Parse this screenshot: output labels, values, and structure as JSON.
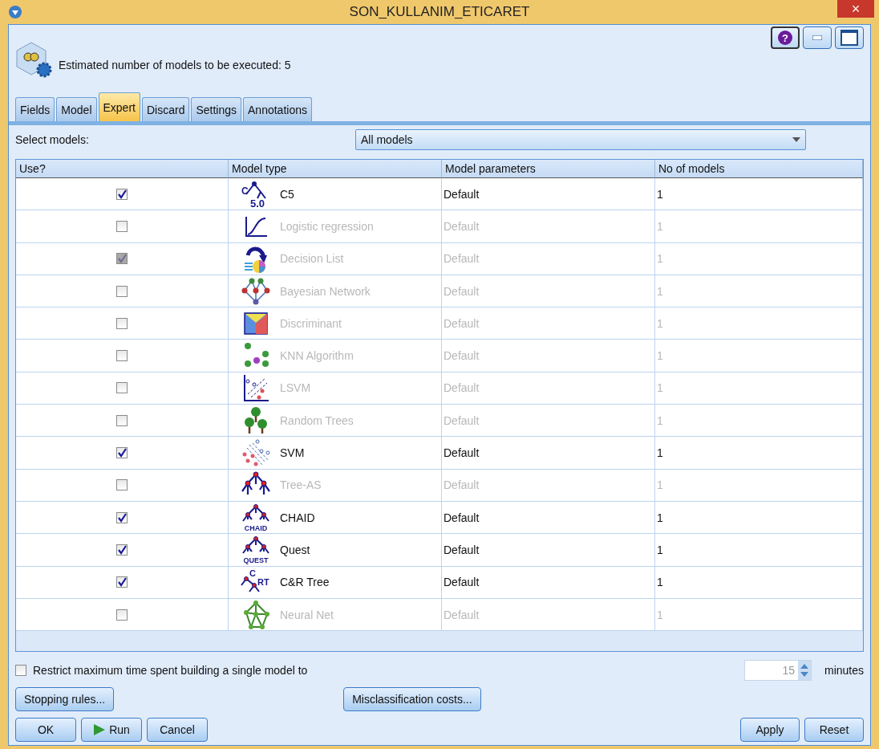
{
  "window": {
    "title": "SON_KULLANIM_ETICARET",
    "close": "×"
  },
  "header": {
    "estimate": "Estimated number of models to be executed: 5",
    "help": "?"
  },
  "tabs": [
    {
      "label": "Fields",
      "selected": false
    },
    {
      "label": "Model",
      "selected": false
    },
    {
      "label": "Expert",
      "selected": true
    },
    {
      "label": "Discard",
      "selected": false
    },
    {
      "label": "Settings",
      "selected": false
    },
    {
      "label": "Annotations",
      "selected": false
    }
  ],
  "select_models": {
    "label": "Select models:",
    "value": "All models"
  },
  "table": {
    "columns": [
      "Use?",
      "Model type",
      "Model parameters",
      "No of models"
    ],
    "rows": [
      {
        "checked": true,
        "disabled": false,
        "enabled": true,
        "kind": "c5",
        "icon_text": [
          "C",
          "5.0"
        ],
        "model": "C5",
        "parameters": "Default",
        "count": "1"
      },
      {
        "checked": false,
        "disabled": false,
        "enabled": false,
        "kind": "curve",
        "icon_text": [],
        "model": "Logistic regression",
        "parameters": "Default",
        "count": "1"
      },
      {
        "checked": true,
        "disabled": true,
        "enabled": false,
        "kind": "list",
        "icon_text": [],
        "model": "Decision List",
        "parameters": "Default",
        "count": "1"
      },
      {
        "checked": false,
        "disabled": false,
        "enabled": false,
        "kind": "bayes",
        "icon_text": [],
        "model": "Bayesian Network",
        "parameters": "Default",
        "count": "1"
      },
      {
        "checked": false,
        "disabled": false,
        "enabled": false,
        "kind": "split",
        "icon_text": [],
        "model": "Discriminant",
        "parameters": "Default",
        "count": "1"
      },
      {
        "checked": false,
        "disabled": false,
        "enabled": false,
        "kind": "cluster",
        "icon_text": [],
        "model": "KNN Algorithm",
        "parameters": "Default",
        "count": "1"
      },
      {
        "checked": false,
        "disabled": false,
        "enabled": false,
        "kind": "scatter",
        "icon_text": [],
        "model": "LSVM",
        "parameters": "Default",
        "count": "1"
      },
      {
        "checked": false,
        "disabled": false,
        "enabled": false,
        "kind": "forest",
        "icon_text": [],
        "model": "Random Trees",
        "parameters": "Default",
        "count": "1"
      },
      {
        "checked": true,
        "disabled": false,
        "enabled": true,
        "kind": "margin",
        "icon_text": [],
        "model": "SVM",
        "parameters": "Default",
        "count": "1"
      },
      {
        "checked": false,
        "disabled": false,
        "enabled": false,
        "kind": "branches",
        "icon_text": [],
        "model": "Tree-AS",
        "parameters": "Default",
        "count": "1"
      },
      {
        "checked": true,
        "disabled": false,
        "enabled": true,
        "kind": "tree",
        "icon_text": [
          "CHAID"
        ],
        "model": "CHAID",
        "parameters": "Default",
        "count": "1"
      },
      {
        "checked": true,
        "disabled": false,
        "enabled": true,
        "kind": "tree",
        "icon_text": [
          "QUEST"
        ],
        "model": "Quest",
        "parameters": "Default",
        "count": "1"
      },
      {
        "checked": true,
        "disabled": false,
        "enabled": true,
        "kind": "crt",
        "icon_text": [
          "C",
          "RT"
        ],
        "model": "C&R Tree",
        "parameters": "Default",
        "count": "1"
      },
      {
        "checked": false,
        "disabled": false,
        "enabled": false,
        "kind": "neural",
        "icon_text": [],
        "model": "Neural Net",
        "parameters": "Default",
        "count": "1"
      }
    ]
  },
  "restrict": {
    "checked": false,
    "label": "Restrict maximum time spent building a single model to",
    "value": "15",
    "unit": "minutes"
  },
  "buttons": [
    {
      "label": "Stopping rules..."
    },
    {
      "label": "Misclassification costs..."
    }
  ],
  "footer": [
    {
      "label": "OK",
      "kind": "plain"
    },
    {
      "label": "Run",
      "kind": "run"
    },
    {
      "label": "Cancel",
      "kind": "plain"
    },
    {
      "label": "Apply",
      "kind": "plain"
    },
    {
      "label": "Reset",
      "kind": "plain"
    }
  ]
}
